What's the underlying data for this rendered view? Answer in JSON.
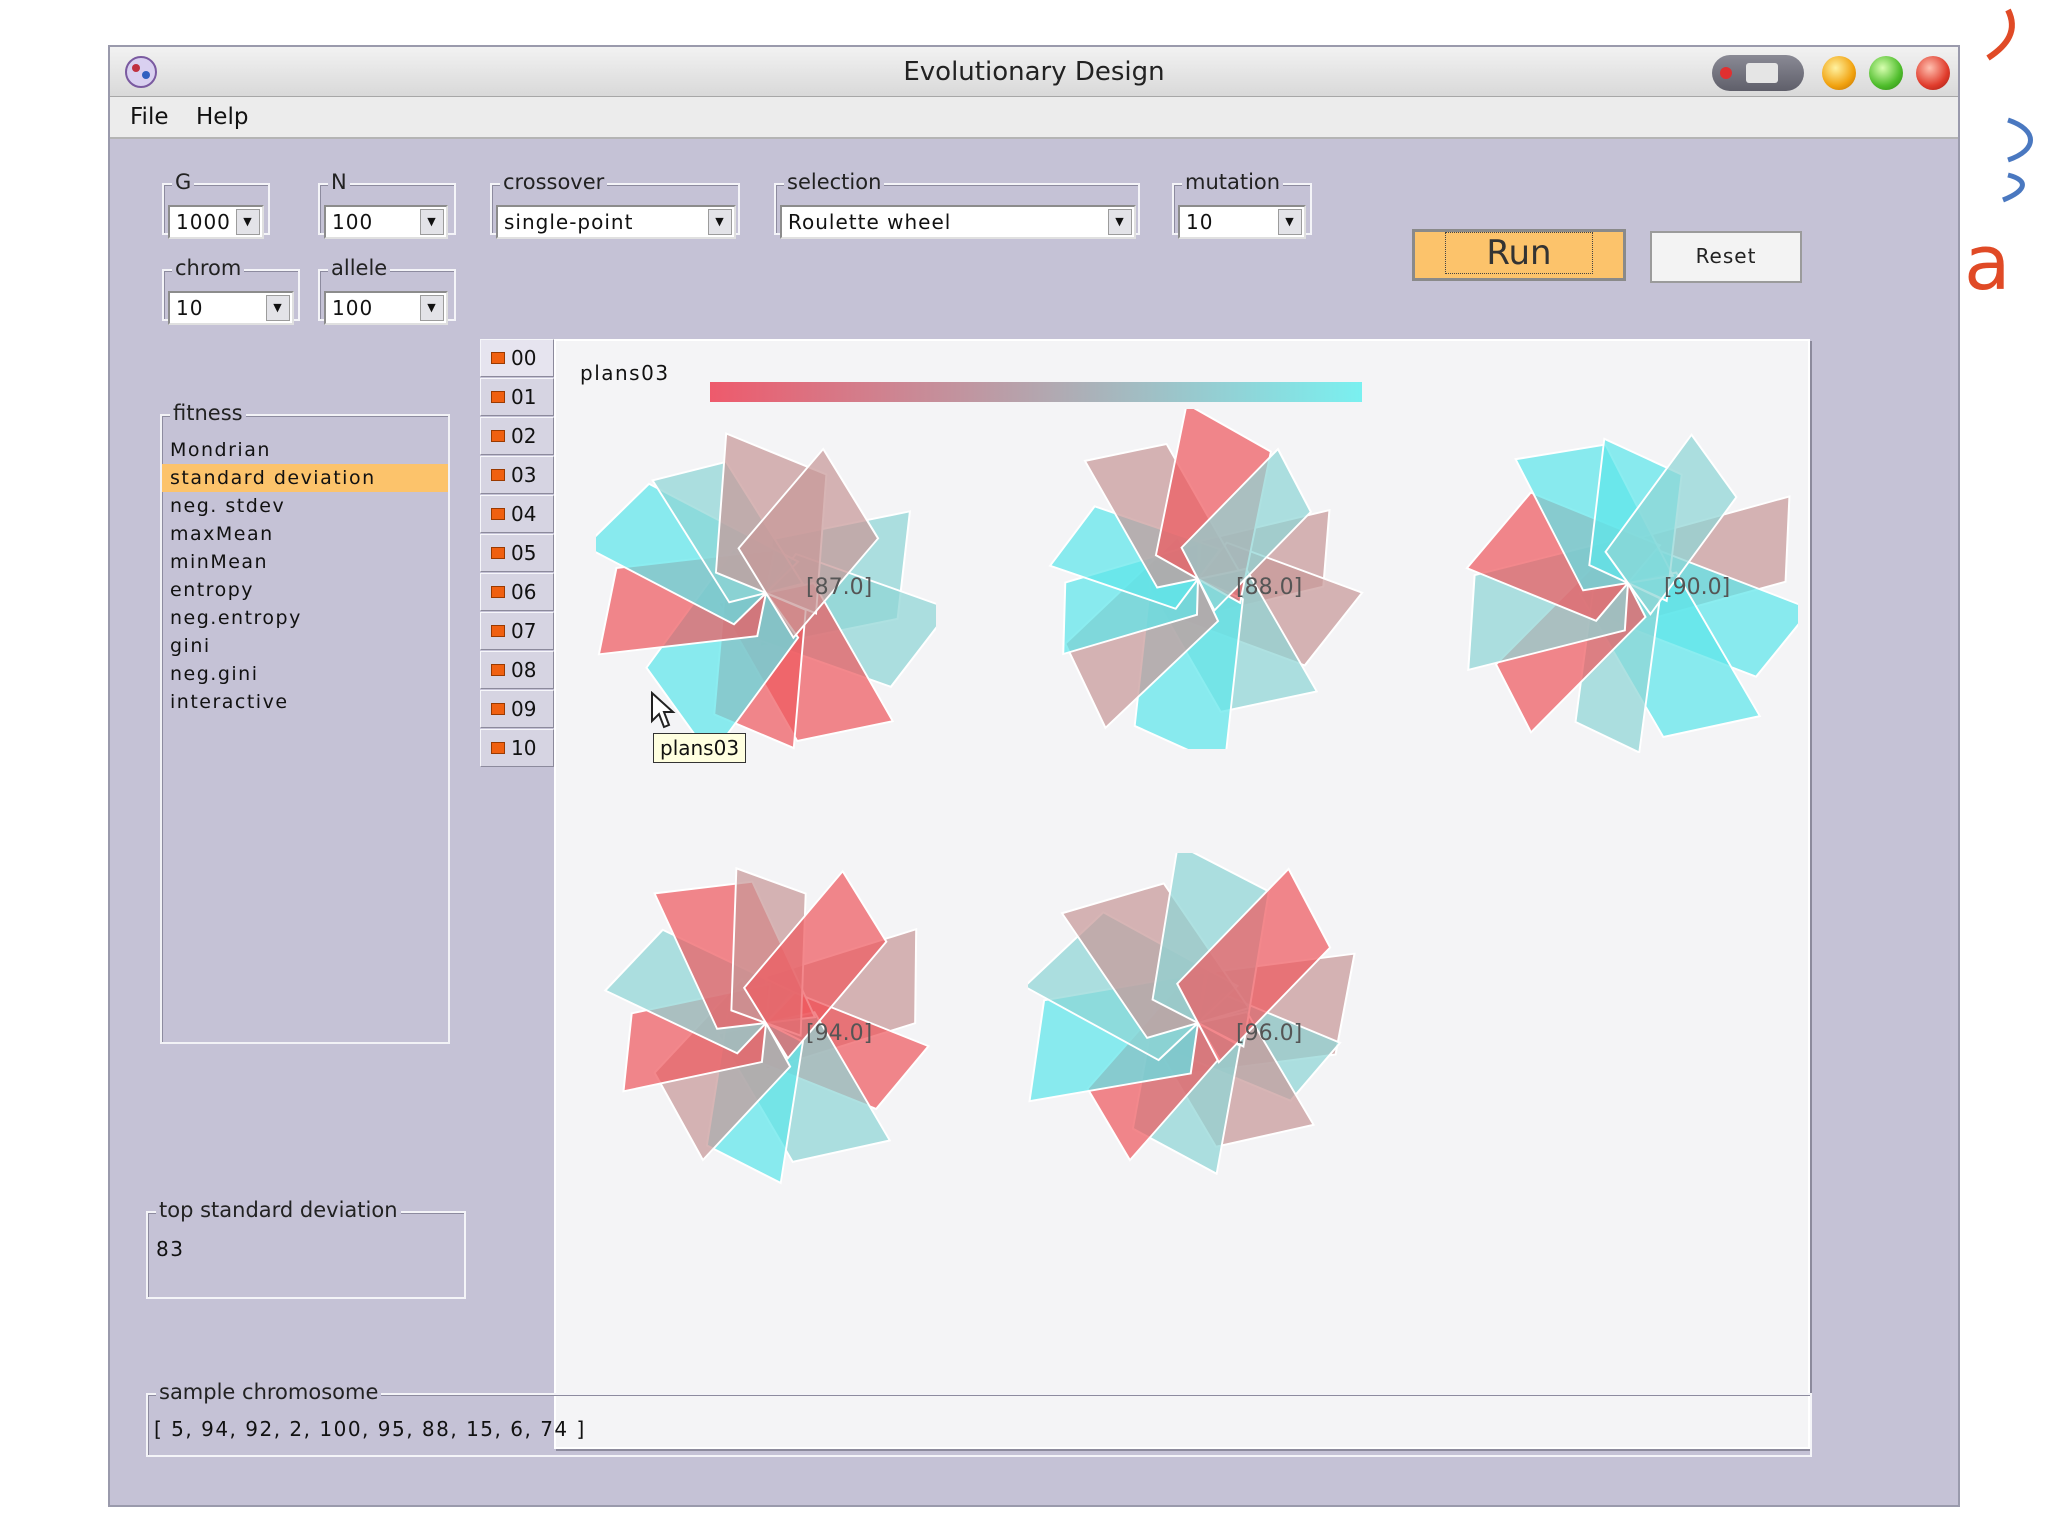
{
  "window": {
    "title": "Evolutionary Design"
  },
  "menu": {
    "items": [
      "File",
      "Help"
    ]
  },
  "params": {
    "G": {
      "label": "G",
      "value": "1000"
    },
    "N": {
      "label": "N",
      "value": "100"
    },
    "crossover": {
      "label": "crossover",
      "value": "single-point"
    },
    "selection": {
      "label": "selection",
      "value": "Roulette wheel"
    },
    "mutation": {
      "label": "mutation",
      "value": "10"
    },
    "chrom": {
      "label": "chrom",
      "value": "10"
    },
    "allele": {
      "label": "allele",
      "value": "100"
    }
  },
  "buttons": {
    "run": "Run",
    "reset": "Reset"
  },
  "fitness": {
    "label": "fitness",
    "items": [
      "Mondrian",
      "standard deviation",
      "neg. stdev",
      "maxMean",
      "minMean",
      "entropy",
      "neg.entropy",
      "gini",
      "neg.gini",
      "interactive"
    ],
    "selected_index": 1
  },
  "generations": {
    "tabs": [
      "00",
      "01",
      "02",
      "03",
      "04",
      "05",
      "06",
      "07",
      "08",
      "09",
      "10"
    ],
    "active": "00"
  },
  "canvas": {
    "label": "plans03",
    "gradient": {
      "from": "#ee5a6c",
      "to": "#7af0f0"
    },
    "designs": [
      {
        "score": "[87.0]"
      },
      {
        "score": "[88.0]"
      },
      {
        "score": "[90.0]"
      },
      {
        "score": "[94.0]"
      },
      {
        "score": "[96.0]"
      }
    ]
  },
  "tooltip": {
    "text": "plans03"
  },
  "top": {
    "label": "top standard deviation",
    "value": "83"
  },
  "sample": {
    "label": "sample chromosome",
    "value": "[ 5, 94, 92, 2, 100, 95, 88, 15, 6, 74 ]"
  },
  "colors": {
    "red": "#ee5a60",
    "cyan": "#5ee6ea",
    "selection": "#fcc36b",
    "panel": "#c5c2d6"
  }
}
